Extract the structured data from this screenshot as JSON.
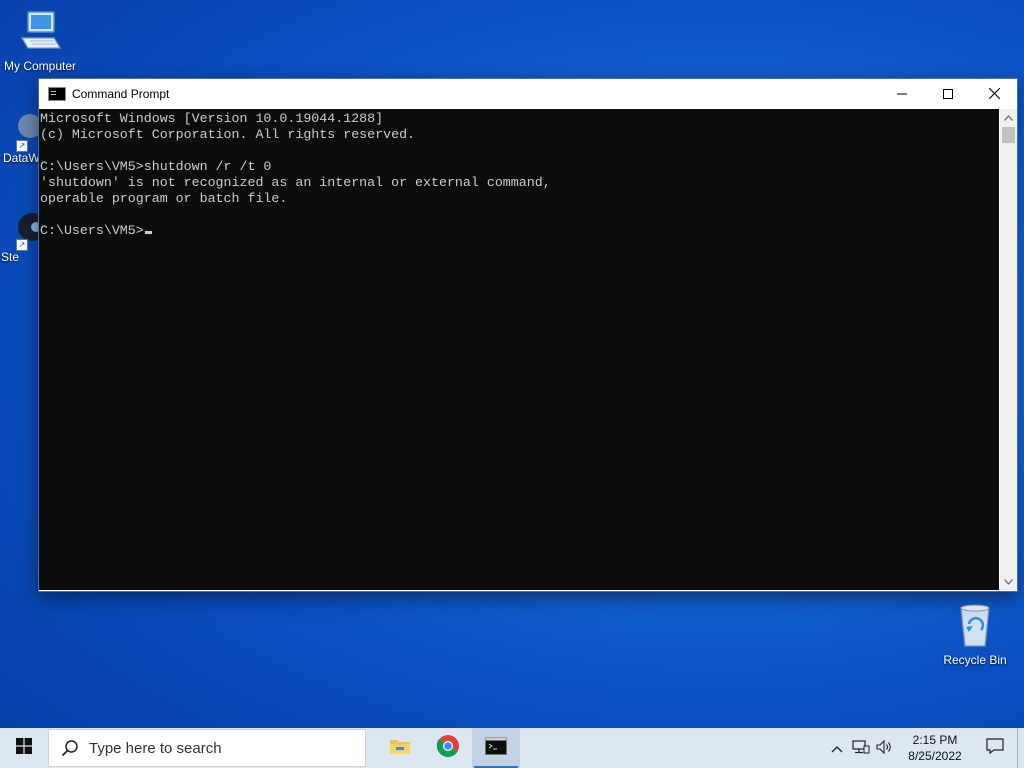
{
  "desktop": {
    "icons": [
      {
        "label": "My Computer",
        "icon": "computer-icon"
      },
      {
        "label": "DataW",
        "icon": "app-shortcut-icon"
      },
      {
        "label": "Ste",
        "icon": "steam-icon"
      },
      {
        "label": "Recycle Bin",
        "icon": "recycle-bin-icon"
      }
    ]
  },
  "window": {
    "title": "Command Prompt",
    "minimize_glyph": "─",
    "maximize_glyph": "☐",
    "close_glyph": "✕"
  },
  "console": {
    "lines": [
      "Microsoft Windows [Version 10.0.19044.1288]",
      "(c) Microsoft Corporation. All rights reserved.",
      "",
      "C:\\Users\\VM5>shutdown /r /t 0",
      "'shutdown' is not recognized as an internal or external command,",
      "operable program or batch file.",
      ""
    ],
    "prompt": "C:\\Users\\VM5>",
    "text_color": "#cccccc",
    "background_color": "#0c0c0c"
  },
  "taskbar": {
    "search_placeholder": "Type here to search",
    "apps": [
      {
        "name": "File Explorer",
        "icon": "folder-icon"
      },
      {
        "name": "Google Chrome",
        "icon": "chrome-icon"
      },
      {
        "name": "Command Prompt",
        "icon": "cmd-icon",
        "active": true
      }
    ],
    "clock_time": "2:15 PM",
    "clock_date": "8/25/2022",
    "accent_color": "#2b78d0"
  }
}
